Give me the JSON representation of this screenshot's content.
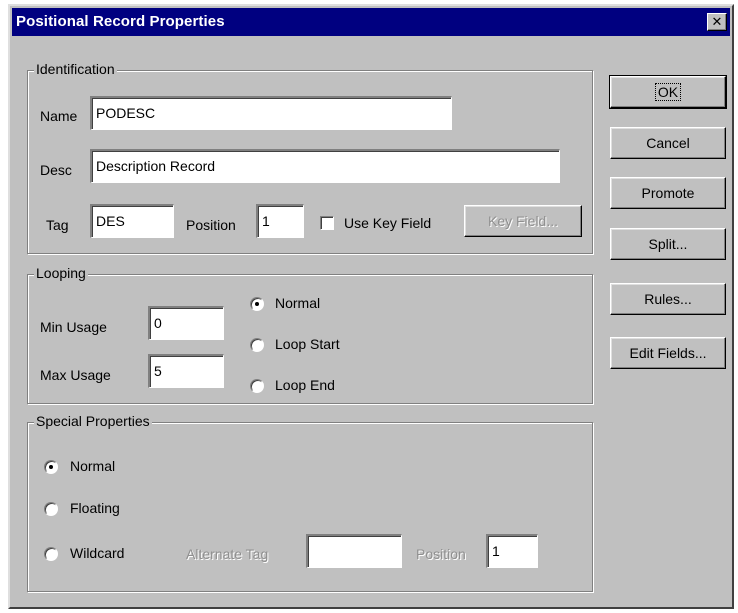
{
  "window": {
    "title": "Positional Record Properties",
    "close_label": "✕"
  },
  "identification": {
    "group_label": "Identification",
    "name_label": "Name",
    "name_value": "PODESC",
    "desc_label": "Desc",
    "desc_value": "Description Record",
    "tag_label": "Tag",
    "tag_value": "DES",
    "position_label": "Position",
    "position_value": "1",
    "use_key_field_label": "Use Key Field",
    "use_key_field_checked": false,
    "key_field_button": "Key Field..."
  },
  "looping": {
    "group_label": "Looping",
    "min_usage_label": "Min Usage",
    "min_usage_value": "0",
    "max_usage_label": "Max Usage",
    "max_usage_value": "5",
    "options": [
      "Normal",
      "Loop Start",
      "Loop End"
    ],
    "selected": "Normal"
  },
  "special": {
    "group_label": "Special Properties",
    "options": [
      "Normal",
      "Floating",
      "Wildcard"
    ],
    "selected": "Normal",
    "alternate_tag_label": "Alternate Tag",
    "alternate_tag_value": "",
    "position_label": "Position",
    "position_value": "1"
  },
  "buttons": {
    "ok": "OK",
    "cancel": "Cancel",
    "promote": "Promote",
    "split": "Split...",
    "rules": "Rules...",
    "edit_fields": "Edit Fields..."
  }
}
